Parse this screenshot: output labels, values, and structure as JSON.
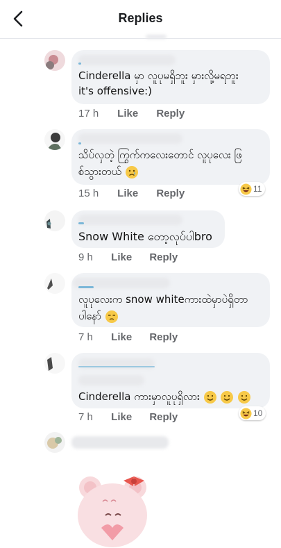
{
  "header": {
    "title": "Replies"
  },
  "comments": [
    {
      "text_line1": "Cinderella မှာ လူပုမရှိဘူး မှားလို့မရဘူး",
      "text_line2": "it's offensive:)",
      "time": "17 h",
      "like": "Like",
      "reply": "Reply"
    },
    {
      "text_line1": "သိပ်လှတဲ့ ကြွက်ကလေးတောင် လူပုလေး ဖြ",
      "text_line2": "စ်သွားတယ်",
      "emoji": "crying-face",
      "time": "15 h",
      "like": "Like",
      "reply": "Reply",
      "reaction_count": "11"
    },
    {
      "text_line1": "Snow White တော့လုပ်ပါbro",
      "time": "9 h",
      "like": "Like",
      "reply": "Reply"
    },
    {
      "text_line1": "လူပုလေးက snow whiteကားထဲမှာပဲရှိတာ",
      "text_line2": "ပါနော်",
      "emoji": "unamused-face",
      "time": "7 h",
      "like": "Like",
      "reply": "Reply"
    },
    {
      "text_line1": "Cinderella ကားမှာလူပုရှိလား",
      "emoji": "smiling-face x3",
      "time": "7 h",
      "like": "Like",
      "reply": "Reply",
      "reaction_count": "10"
    }
  ],
  "colors": {
    "bubble": "#f0f2f5",
    "meta": "#65676b",
    "divider": "#e4e6eb"
  }
}
